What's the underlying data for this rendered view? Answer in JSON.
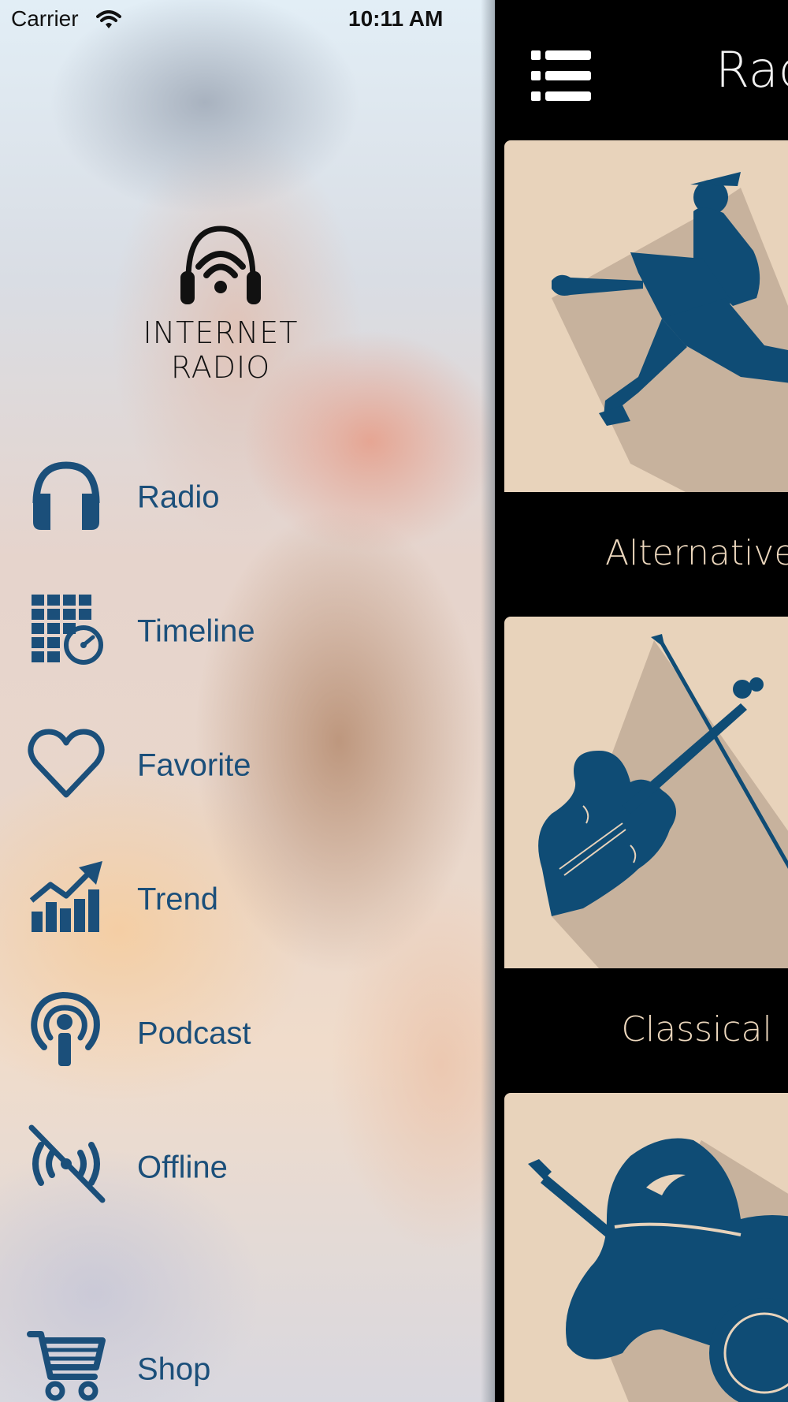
{
  "status_bar": {
    "carrier": "Carrier",
    "time": "10:11 AM"
  },
  "drawer": {
    "logo_text": "INTERNET RADIO",
    "items": [
      {
        "label": "Radio",
        "icon": "headphones-icon"
      },
      {
        "label": "Timeline",
        "icon": "calendar-clock-icon"
      },
      {
        "label": "Favorite",
        "icon": "heart-icon"
      },
      {
        "label": "Trend",
        "icon": "trending-chart-icon"
      },
      {
        "label": "Podcast",
        "icon": "podcast-icon"
      },
      {
        "label": "Offline",
        "icon": "offline-icon"
      },
      {
        "label": "Shop",
        "icon": "cart-icon"
      }
    ]
  },
  "main": {
    "title": "Radio",
    "genres": [
      {
        "label": "Alternative",
        "icon": "guitarist-icon"
      },
      {
        "label": "Classical",
        "icon": "violin-icon"
      },
      {
        "label": "",
        "icon": "country-hat-banjo-icon"
      }
    ]
  },
  "colors": {
    "accent": "#1b4f7a",
    "card_bg": "#e8d3bb",
    "label_color": "#ecd7bd"
  }
}
